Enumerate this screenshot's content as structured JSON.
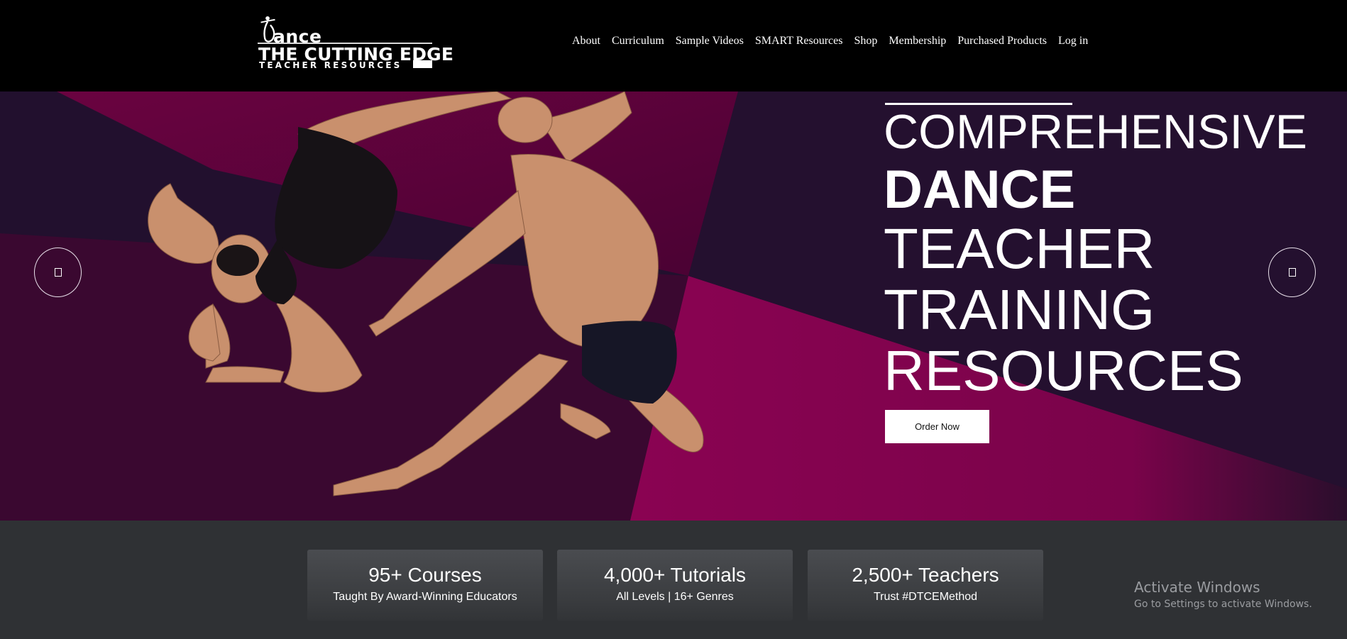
{
  "header": {
    "logo": {
      "line1": "ance",
      "line2": "THE CUTTING EDGE",
      "line3": "TEACHER RESOURCES"
    },
    "nav": [
      "About",
      "Curriculum",
      "Sample Videos",
      "SMART Resources",
      "Shop",
      "Membership",
      "Purchased Products",
      "Log in"
    ]
  },
  "hero": {
    "headline": {
      "line1": "COMPREHENSIVE",
      "line2": "DANCE",
      "line3": "TEACHER",
      "line4": "TRAINING",
      "line5": "RESOURCES"
    },
    "cta_label": "Order Now",
    "prev_icon": "arrow-left-icon",
    "next_icon": "arrow-right-icon",
    "colors": {
      "dark_purple": "#22102e",
      "magenta": "#8a0352",
      "wine": "#5a0238"
    }
  },
  "stats": [
    {
      "big": "95+ Courses",
      "small": "Taught By Award-Winning Educators"
    },
    {
      "big": "4,000+ Tutorials",
      "small": "All Levels | 16+ Genres"
    },
    {
      "big": "2,500+ Teachers",
      "small": "Trust #DTCEMethod"
    }
  ],
  "watermark": {
    "title": "Activate Windows",
    "subtitle": "Go to Settings to activate Windows."
  }
}
